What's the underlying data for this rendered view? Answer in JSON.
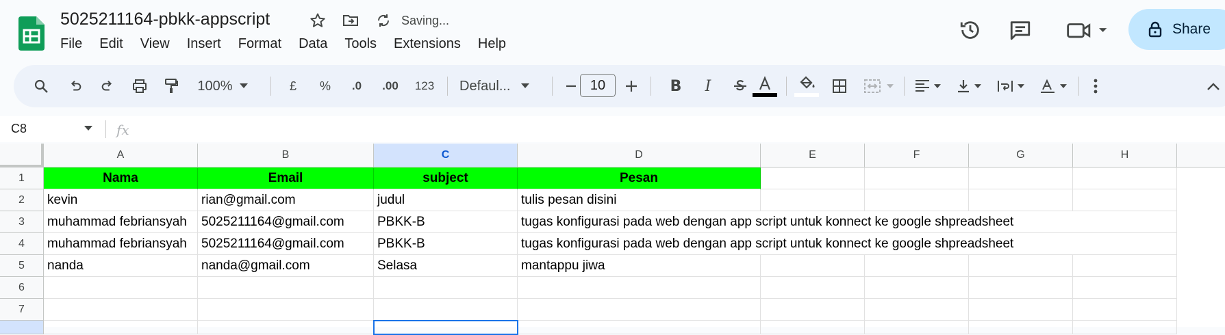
{
  "doc": {
    "title": "5025211164-pbkk-appscript",
    "status": "Saving...",
    "share_label": "Share"
  },
  "menu": [
    "File",
    "Edit",
    "View",
    "Insert",
    "Format",
    "Data",
    "Tools",
    "Extensions",
    "Help"
  ],
  "toolbar": {
    "zoom": "100%",
    "currency": "£",
    "percent": "%",
    "decrease_decimal": ".0",
    "increase_decimal": ".00",
    "number_format": "123",
    "font": "Defaul...",
    "font_size": "10"
  },
  "formula": {
    "name_box": "C8",
    "fx": "fx"
  },
  "columns": [
    "A",
    "B",
    "C",
    "D",
    "E",
    "F",
    "G",
    "H"
  ],
  "selected_column": "C",
  "rows": [
    "1",
    "2",
    "3",
    "4",
    "5",
    "6",
    "7"
  ],
  "cells": {
    "r1": [
      "Nama",
      "Email",
      "subject",
      "Pesan"
    ],
    "r2": [
      "kevin",
      "rian@gmail.com",
      "judul",
      "tulis pesan disini"
    ],
    "r3": [
      "muhammad febriansyah",
      "5025211164@gmail.com",
      "PBKK-B",
      "tugas konfigurasi pada web dengan app script untuk konnect ke google shpreadsheet"
    ],
    "r4": [
      "muhammad febriansyah",
      "5025211164@gmail.com",
      "PBKK-B",
      "tugas konfigurasi pada web dengan app script untuk konnect ke google shpreadsheet"
    ],
    "r5": [
      "nanda",
      "nanda@gmail.com",
      "Selasa",
      "mantappu jiwa"
    ]
  },
  "colors": {
    "header_fill": "#00ff00",
    "accent": "#0b57d0",
    "share_bg": "#c2e7ff"
  },
  "icons": {
    "logo": "sheets-logo-icon",
    "star": "star-icon",
    "move": "move-to-folder-icon",
    "sync": "cloud-sync-icon",
    "history": "history-icon",
    "comments": "comment-icon",
    "meet": "video-camera-icon",
    "lock": "lock-icon"
  }
}
